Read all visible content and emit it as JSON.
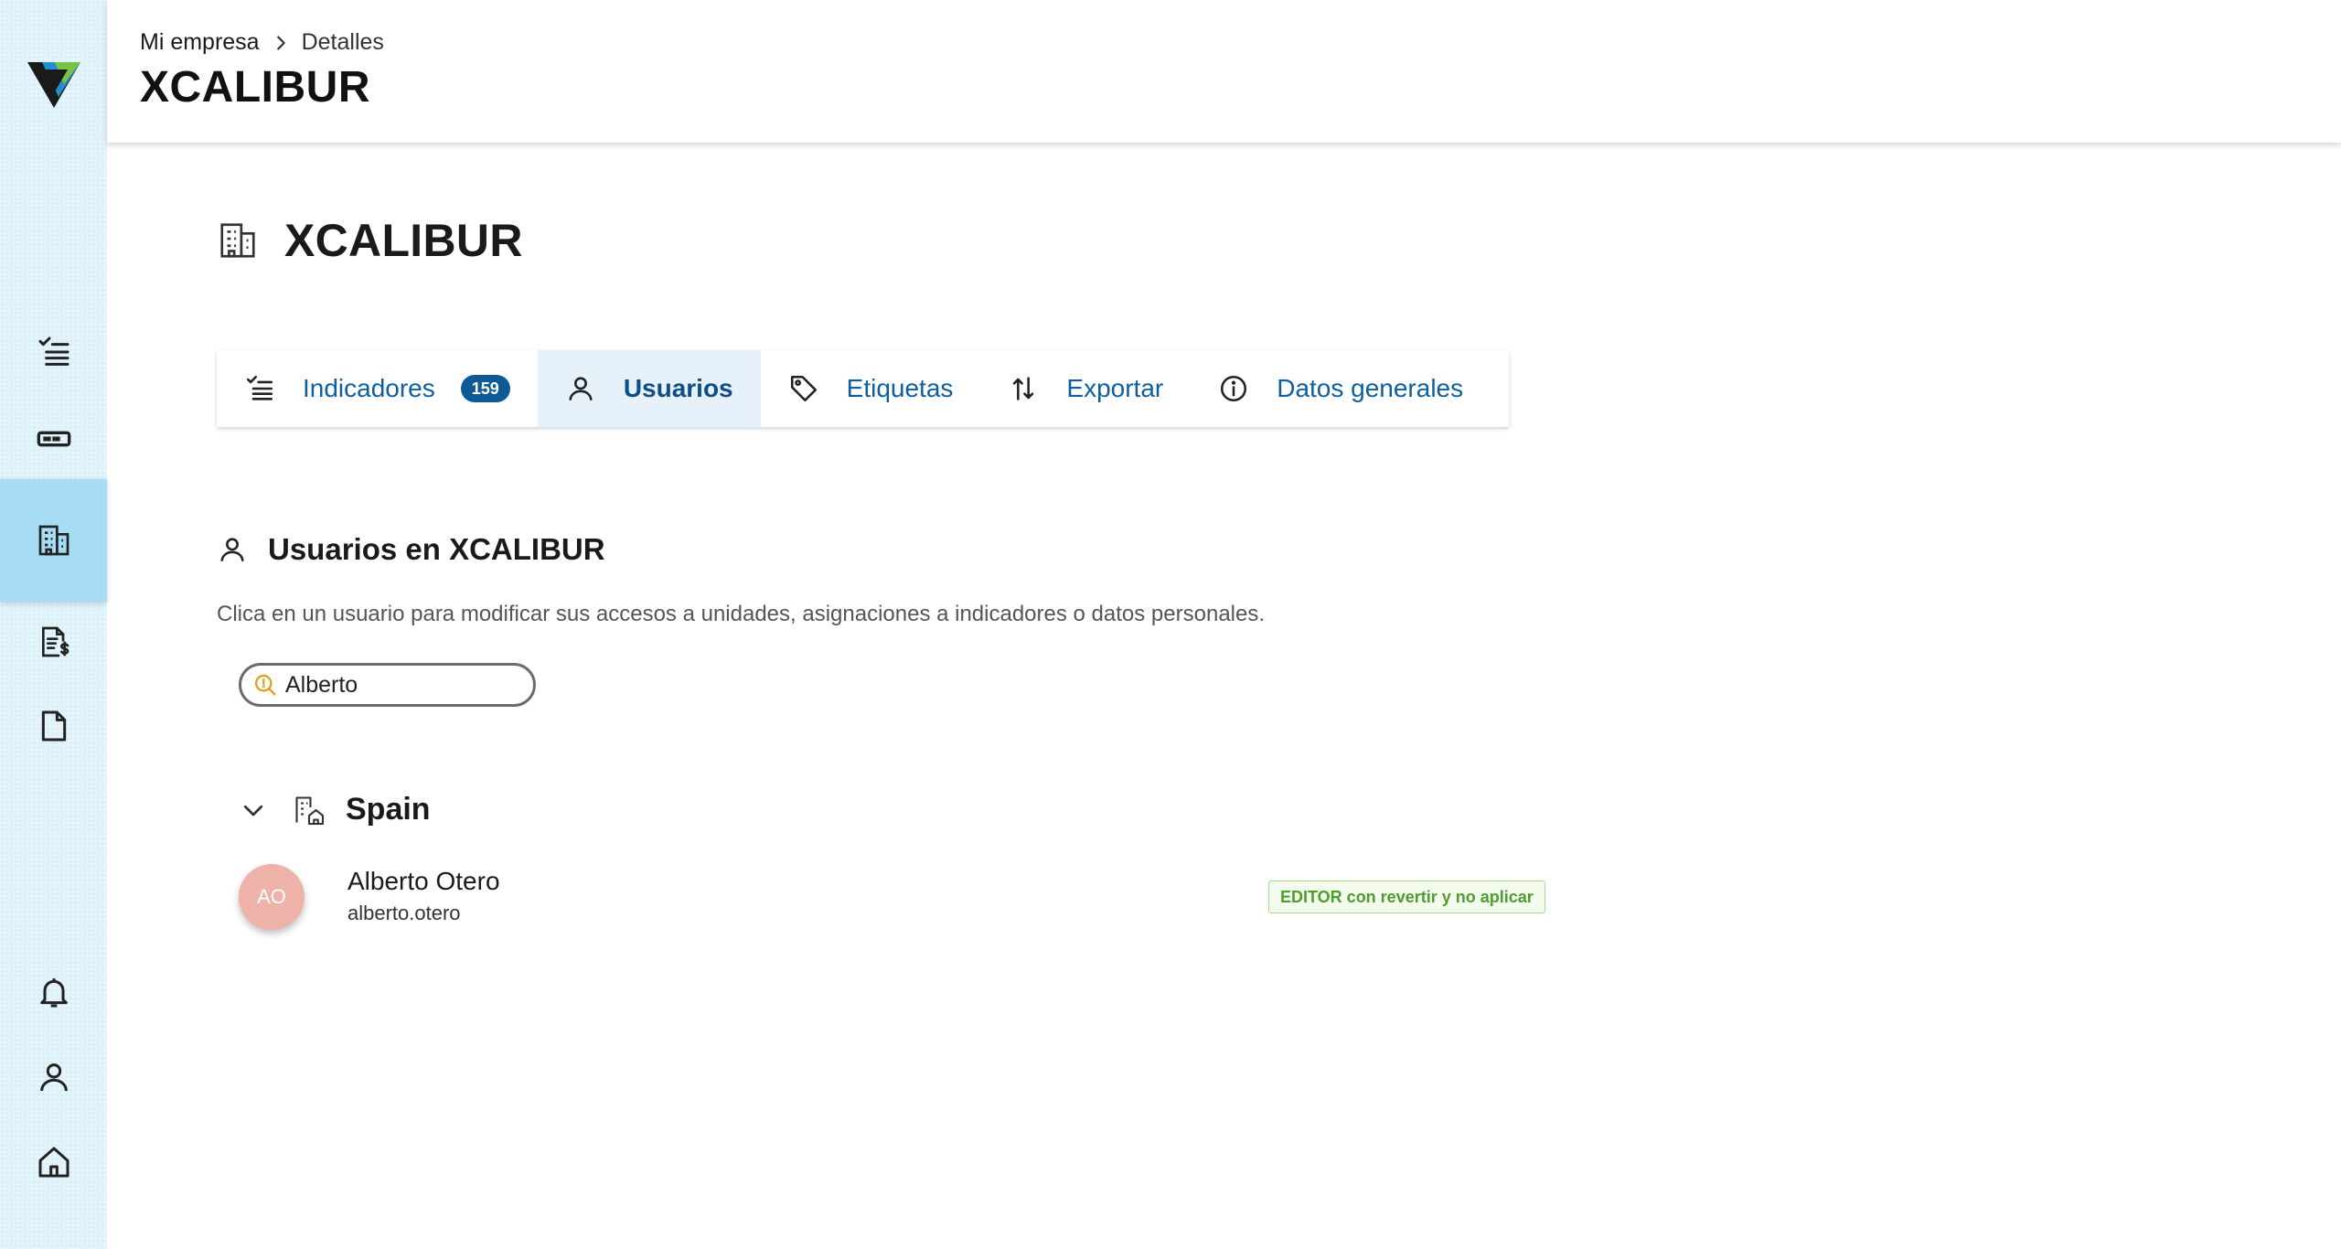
{
  "sidebar": {
    "logo_icon": "app-logo-icon",
    "items": [
      {
        "name": "indicators",
        "icon": "checklist-icon"
      },
      {
        "name": "progress",
        "icon": "battery-bar-icon"
      },
      {
        "name": "companies",
        "icon": "building-icon",
        "active": true
      },
      {
        "name": "invoices",
        "icon": "document-dollar-icon"
      },
      {
        "name": "documents",
        "icon": "file-icon"
      },
      {
        "name": "notifications",
        "icon": "bell-icon"
      },
      {
        "name": "profile",
        "icon": "user-icon"
      },
      {
        "name": "home",
        "icon": "home-icon"
      }
    ],
    "active_color": "#a7ddf4"
  },
  "header": {
    "breadcrumb": [
      "Mi empresa",
      "Detalles"
    ],
    "title": "XCALIBUR"
  },
  "page": {
    "title": "XCALIBUR",
    "title_icon": "building-icon"
  },
  "tabs": [
    {
      "label": "Indicadores",
      "icon": "checklist-icon",
      "badge": "159",
      "active": false
    },
    {
      "label": "Usuarios",
      "icon": "user-icon",
      "active": true
    },
    {
      "label": "Etiquetas",
      "icon": "tag-icon",
      "active": false
    },
    {
      "label": "Exportar",
      "icon": "sort-arrows-icon",
      "active": false
    },
    {
      "label": "Datos generales",
      "icon": "info-icon",
      "active": false
    }
  ],
  "users_section": {
    "title": "Usuarios en XCALIBUR",
    "description": "Clica en un usuario para modificar sus accesos a unidades, asignaciones a indicadores o datos personales.",
    "search": {
      "value": "Alberto",
      "placeholder": ""
    }
  },
  "groups": [
    {
      "name": "Spain",
      "expanded": true,
      "users": [
        {
          "initials": "AO",
          "name": "Alberto Otero",
          "login": "alberto.otero",
          "role": "EDITOR con revertir y no aplicar"
        }
      ]
    }
  ],
  "colors": {
    "accent": "#0d5fa0",
    "badge_bg": "#0d5a96",
    "avatar": "#eeb2a8",
    "role_green": "#4f9c2f",
    "search_icon": "#e0a020"
  }
}
